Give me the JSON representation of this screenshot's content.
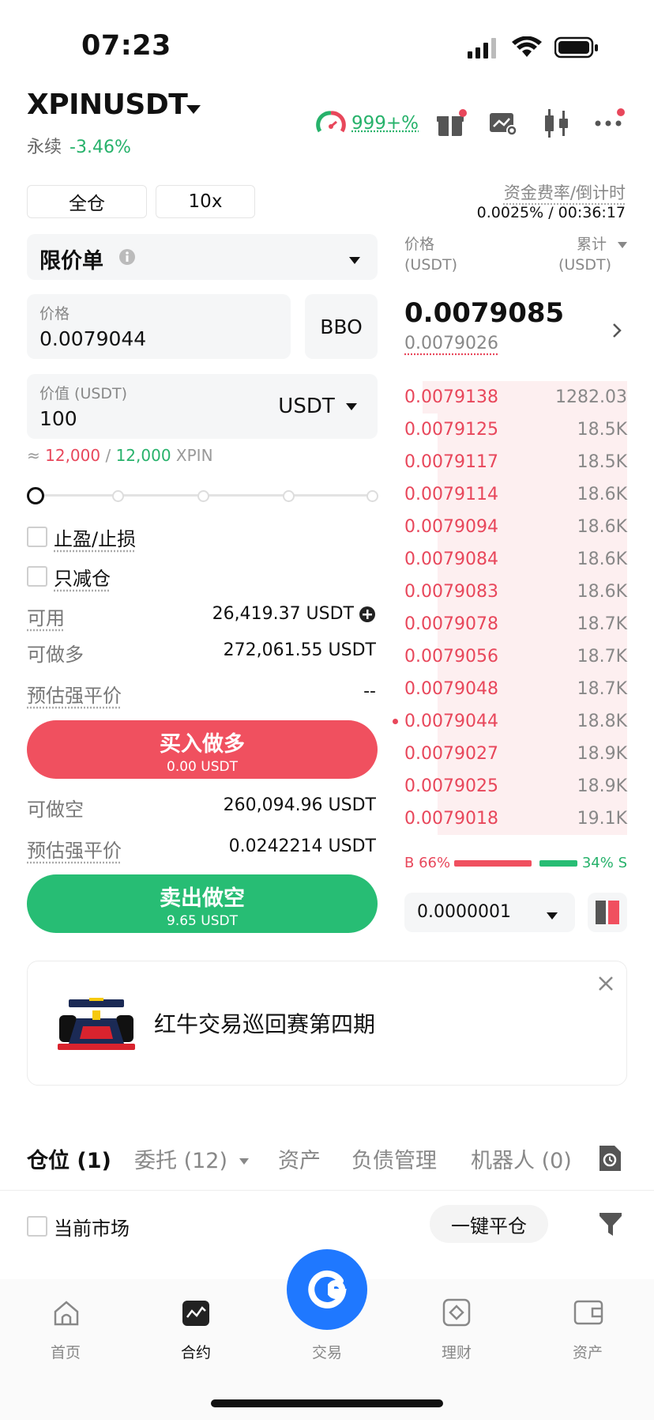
{
  "status": {
    "time": "07:23"
  },
  "header": {
    "symbol": "XPINUSDT",
    "contract_type": "永续",
    "change": "-3.46%",
    "gauge_text": "999+%"
  },
  "margin": {
    "mode": "全仓",
    "leverage": "10x"
  },
  "funding": {
    "label": "资金费率/倒计时",
    "value": "0.0025% / 00:36:17"
  },
  "order_form": {
    "order_type": "限价单",
    "price_label": "价格",
    "price_value": "0.0079044",
    "bbo": "BBO",
    "value_label": "价值 (USDT)",
    "value_value": "100",
    "value_unit": "USDT",
    "estimate_prefix": "≈",
    "est_buy": "12,000",
    "est_sep": "/",
    "est_sell": "12,000",
    "est_unit": "XPIN",
    "slider_level": 0,
    "tp_sl": "止盈/止损",
    "reduce_only": "只减仓",
    "available_label": "可用",
    "available_value": "26,419.37 USDT",
    "long_max_label": "可做多",
    "long_max_value": "272,061.55 USDT",
    "liq_label_1": "预估强平价",
    "liq_value_1": "--",
    "buy_label": "买入做多",
    "buy_sub": "0.00 USDT",
    "short_max_label": "可做空",
    "short_max_value": "260,094.96 USDT",
    "liq_label_2": "预估强平价",
    "liq_value_2": "0.0242214 USDT",
    "sell_label": "卖出做空",
    "sell_sub": "9.65 USDT"
  },
  "orderbook": {
    "price_header": "价格",
    "price_unit": "(USDT)",
    "cum_header": "累计",
    "cum_unit": "(USDT)",
    "last_price": "0.0079085",
    "mark_price": "0.0079026",
    "asks": [
      {
        "price": "0.0079138",
        "qty": "1282.03",
        "depth": 0.92
      },
      {
        "price": "0.0079125",
        "qty": "18.5K",
        "depth": 0.85
      },
      {
        "price": "0.0079117",
        "qty": "18.5K",
        "depth": 0.85
      },
      {
        "price": "0.0079114",
        "qty": "18.6K",
        "depth": 0.85
      },
      {
        "price": "0.0079094",
        "qty": "18.6K",
        "depth": 0.85
      },
      {
        "price": "0.0079084",
        "qty": "18.6K",
        "depth": 0.85
      },
      {
        "price": "0.0079083",
        "qty": "18.6K",
        "depth": 0.85
      },
      {
        "price": "0.0079078",
        "qty": "18.7K",
        "depth": 0.85
      },
      {
        "price": "0.0079056",
        "qty": "18.7K",
        "depth": 0.85
      },
      {
        "price": "0.0079048",
        "qty": "18.7K",
        "depth": 0.85
      },
      {
        "price": "0.0079044",
        "qty": "18.8K",
        "depth": 0.85
      },
      {
        "price": "0.0079027",
        "qty": "18.9K",
        "depth": 0.85
      },
      {
        "price": "0.0079025",
        "qty": "18.9K",
        "depth": 0.85
      },
      {
        "price": "0.0079018",
        "qty": "19.1K",
        "depth": 0.85
      }
    ],
    "buy_ratio_label": "B 66%",
    "sell_ratio_label": "34% S",
    "buy_ratio": 66,
    "precision": "0.0000001"
  },
  "banner": {
    "title": "红牛交易巡回赛第四期"
  },
  "tabs": [
    {
      "label": "仓位 (1)"
    },
    {
      "label": "委托 (12)"
    },
    {
      "label": "资产"
    },
    {
      "label": "负债管理"
    },
    {
      "label": "机器人 (0)"
    }
  ],
  "filters": {
    "current_market": "当前市场",
    "close_all": "一键平仓"
  },
  "bottom_nav": [
    {
      "label": "首页"
    },
    {
      "label": "合约"
    },
    {
      "label": "交易"
    },
    {
      "label": "理财"
    },
    {
      "label": "资产"
    }
  ]
}
